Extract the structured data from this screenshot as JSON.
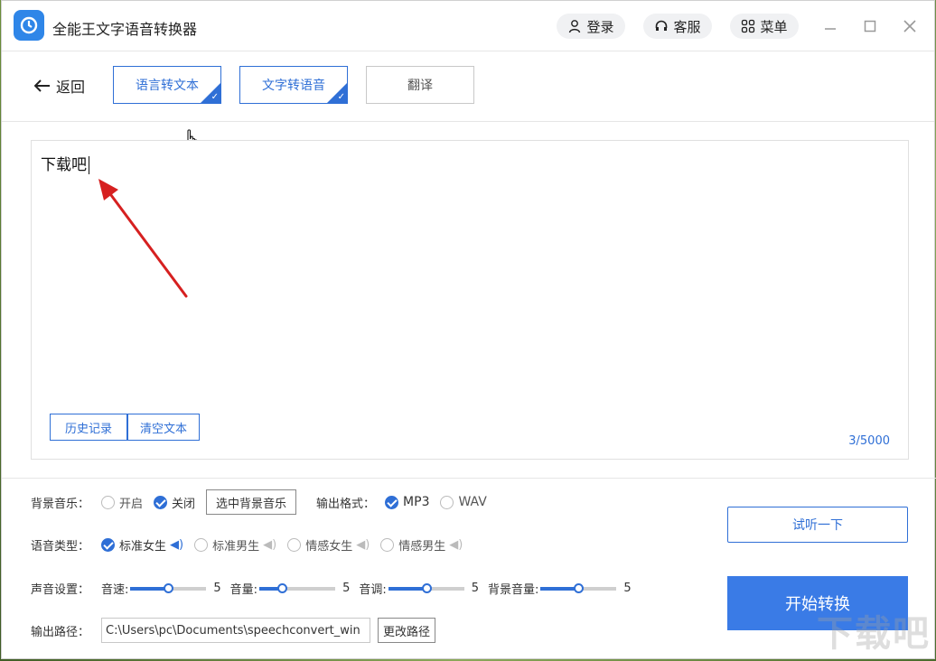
{
  "app": {
    "title": "全能王文字语音转换器"
  },
  "titlebar": {
    "login": "登录",
    "service": "客服",
    "menu": "菜单"
  },
  "nav": {
    "back": "返回",
    "tabs": [
      {
        "label": "语言转文本",
        "active": true
      },
      {
        "label": "文字转语音",
        "active": true
      },
      {
        "label": "翻译",
        "active": false
      }
    ]
  },
  "editor": {
    "text": "下载吧",
    "history_button": "历史记录",
    "clear_button": "清空文本",
    "counter": "3/5000"
  },
  "settings": {
    "bg_music": {
      "label": "背景音乐：",
      "options": [
        "开启",
        "关闭"
      ],
      "selected": "关闭",
      "choose_button": "选中背景音乐"
    },
    "output_format": {
      "label": "输出格式：",
      "options": [
        "MP3",
        "WAV"
      ],
      "selected": "MP3"
    },
    "voice_type": {
      "label": "语音类型：",
      "options": [
        "标准女生",
        "标准男生",
        "情感女生",
        "情感男生"
      ],
      "selected": "标准女生"
    },
    "sound": {
      "label": "声音设置：",
      "sliders": [
        {
          "label": "音速:",
          "value": "5"
        },
        {
          "label": "音量:",
          "value": "5"
        },
        {
          "label": "音调:",
          "value": "5"
        },
        {
          "label": "背景音量:",
          "value": "5"
        }
      ]
    },
    "output_path": {
      "label": "输出路径：",
      "value": "C:\\Users\\pc\\Documents\\speechconvert_win",
      "change_button": "更改路径"
    }
  },
  "actions": {
    "preview": "试听一下",
    "convert": "开始转换"
  },
  "watermark": "下载吧",
  "colors": {
    "accent": "#2f6fd6",
    "convert_bg": "#3a7be6",
    "arrow": "#d62020"
  }
}
